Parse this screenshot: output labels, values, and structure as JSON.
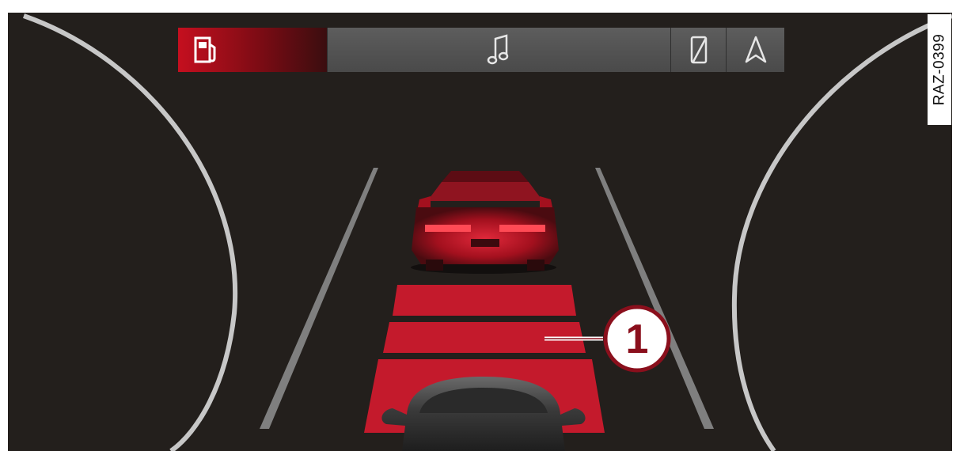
{
  "reference_code": "RAZ-0399",
  "callout": {
    "number": "1"
  },
  "top_bar": {
    "tabs": [
      {
        "id": "fuel",
        "icon": "fuel-pump-icon",
        "active": true
      },
      {
        "id": "media",
        "icon": "music-note-icon",
        "active": false
      },
      {
        "id": "phone",
        "icon": "phone-off-icon",
        "active": false
      },
      {
        "id": "navigation",
        "icon": "navigation-arrow-icon",
        "active": false
      }
    ]
  },
  "colors": {
    "background": "#231f1c",
    "accent_red": "#c8102e",
    "warning_zone_red": "#c41a2c",
    "gauge_ring": "#c7c7c7",
    "lane_line": "#8a8a8a",
    "tab_inactive": "#555555"
  },
  "warning_zone": {
    "segments": 3
  }
}
